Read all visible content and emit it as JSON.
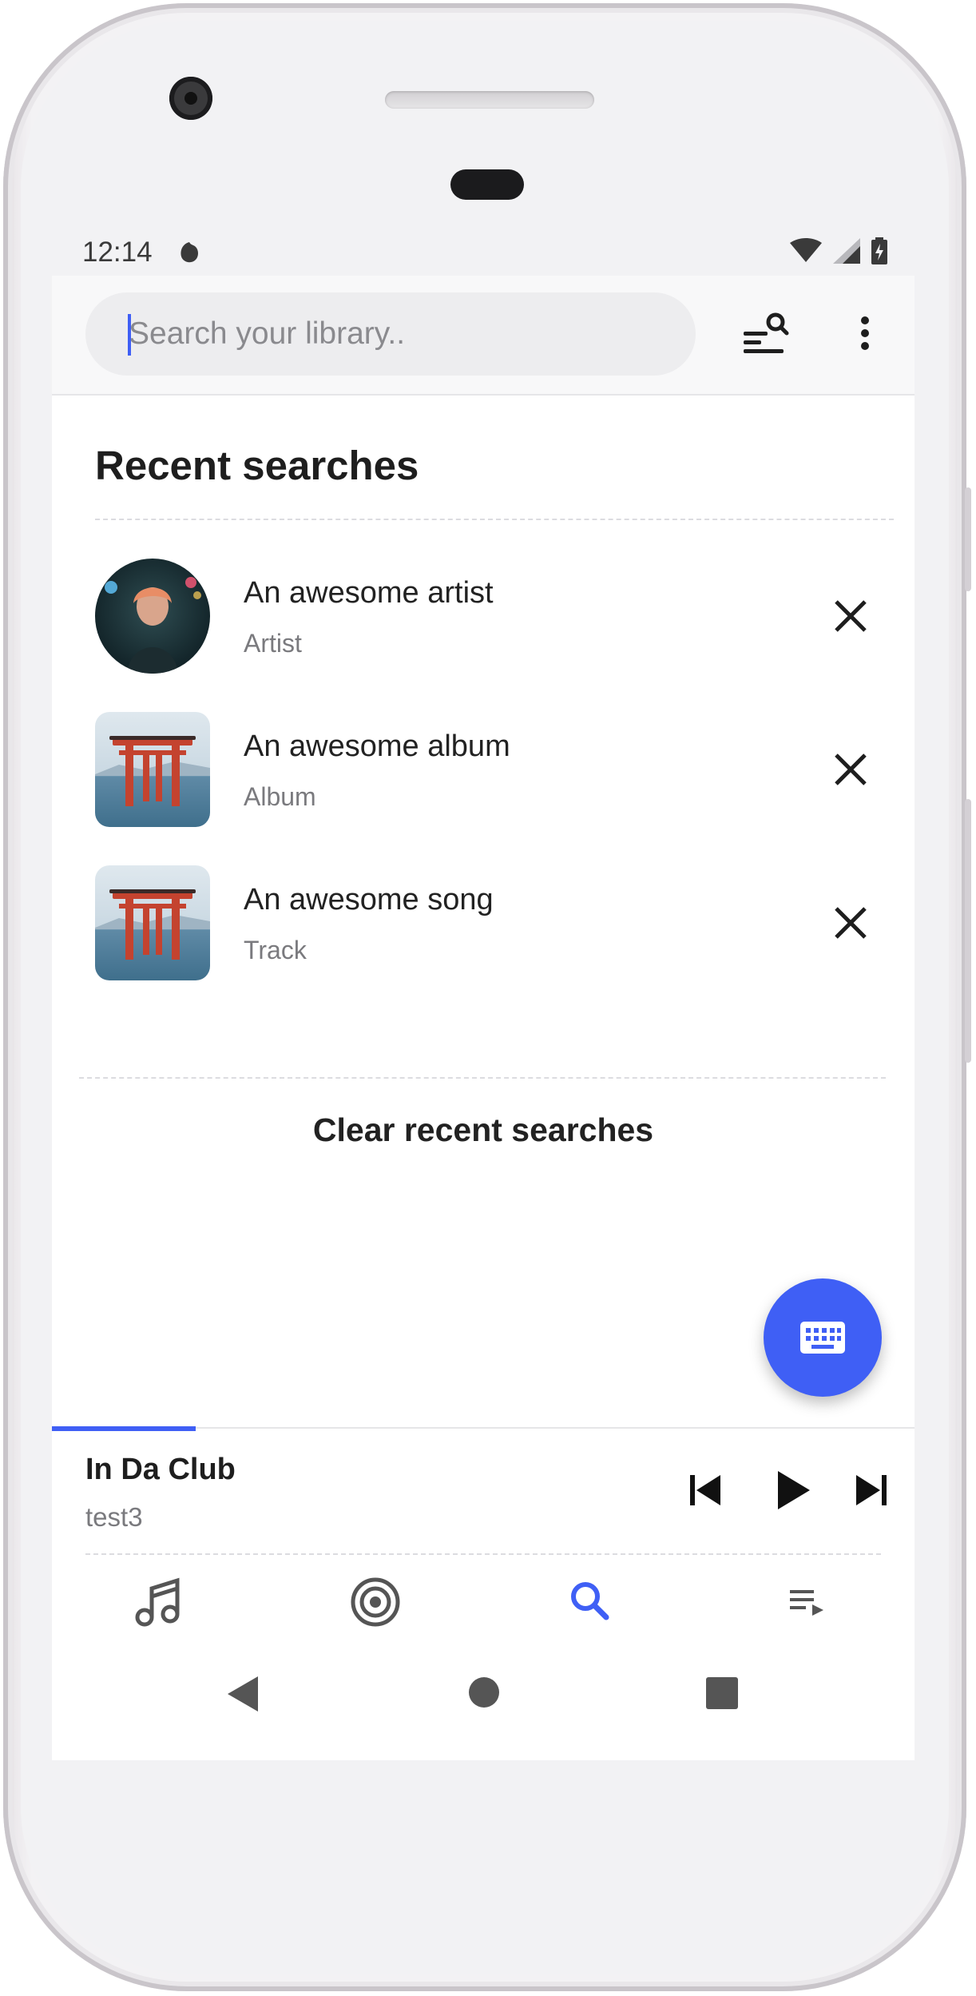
{
  "status_bar": {
    "time": "12:14"
  },
  "search": {
    "placeholder": "Search your library.."
  },
  "recent": {
    "title": "Recent searches",
    "items": [
      {
        "title": "An awesome artist",
        "type": "Artist",
        "thumb": "artist-photo"
      },
      {
        "title": "An awesome album",
        "type": "Album",
        "thumb": "torii-gate-photo"
      },
      {
        "title": "An awesome song",
        "type": "Track",
        "thumb": "torii-gate-photo"
      }
    ],
    "clear_label": "Clear recent searches"
  },
  "player": {
    "title": "In Da Club",
    "artist": "test3",
    "progress": 0.167
  },
  "nav": {
    "items": [
      {
        "icon": "music-note-icon",
        "active": false
      },
      {
        "icon": "podcast-icon",
        "active": false
      },
      {
        "icon": "search-icon",
        "active": true
      },
      {
        "icon": "queue-icon",
        "active": false
      }
    ]
  },
  "colors": {
    "accent": "#3f5ff5",
    "text": "#1e1e1e",
    "muted": "#7a7a7e",
    "status_bar": "#f2f2f4"
  }
}
